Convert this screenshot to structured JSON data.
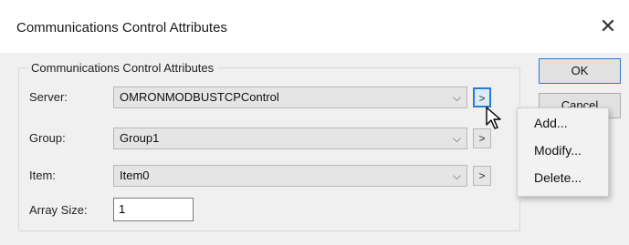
{
  "window": {
    "title": "Communications Control Attributes",
    "close_glyph": "✕"
  },
  "group": {
    "label": "Communications Control Attributes"
  },
  "fields": {
    "server": {
      "label": "Server:",
      "value": "OMRONMODBUSTCPControl"
    },
    "group": {
      "label": "Group:",
      "value": "Group1"
    },
    "item": {
      "label": "Item:",
      "value": "Item0"
    },
    "array_size": {
      "label": "Array Size:",
      "value": "1"
    }
  },
  "combo_arrow_glyph": "⌵",
  "more_button_glyph": ">",
  "buttons": {
    "ok": "OK",
    "cancel": "Cancel"
  },
  "context_menu": {
    "items": [
      "Add...",
      "Modify...",
      "Delete..."
    ]
  },
  "colors": {
    "accent": "#2b7bd0",
    "dialog_bg": "#f0f0f0"
  }
}
